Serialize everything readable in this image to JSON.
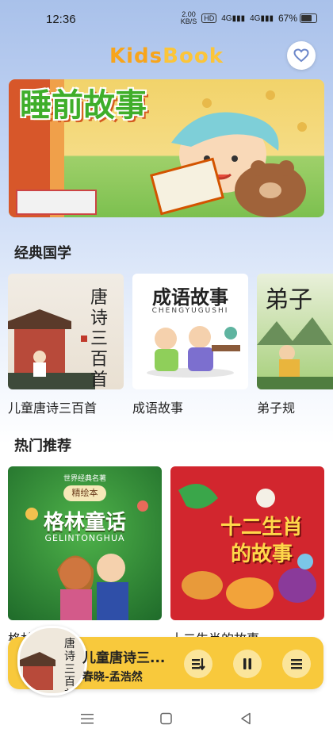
{
  "status": {
    "time": "12:36",
    "net_speed": "2.00",
    "net_unit": "KB/S",
    "hd": "HD",
    "signal1": "4G",
    "signal2": "4G",
    "battery": "67%",
    "battery_level": 0.67
  },
  "app": {
    "title_part1": "Kids",
    "title_part2": "Book"
  },
  "banner": {
    "title": "睡前故事"
  },
  "classic": {
    "heading": "经典国学",
    "items": [
      {
        "label": "儿童唐诗三百首",
        "cover_text": "唐诗三百首"
      },
      {
        "label": "成语故事",
        "cover_text": "成语故事",
        "cover_sub": "CHENGYUGUSHI"
      },
      {
        "label": "弟子规",
        "cover_text": "弟子"
      }
    ]
  },
  "hot": {
    "heading": "热门推荐",
    "items": [
      {
        "label": "格林童话",
        "cover_badge": "精绘本",
        "cover_top": "世界经典名著",
        "cover_text": "格林童话",
        "cover_sub": "GELINTONGHUA"
      },
      {
        "label": "十二生肖的故事",
        "cover_text": "十二生肖的故事"
      }
    ]
  },
  "player": {
    "title": "儿童唐诗三...",
    "subtitle": "春晓-孟浩然",
    "art_text": "唐诗三百首"
  },
  "colors": {
    "accent": "#f8c93c",
    "logo_orange": "#f7a51c"
  }
}
